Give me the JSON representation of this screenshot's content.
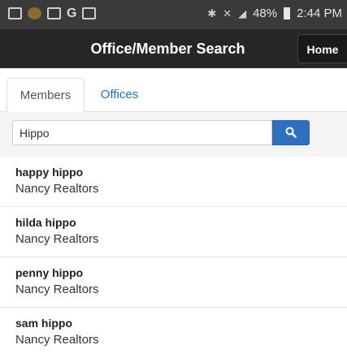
{
  "status_bar": {
    "battery": "48%",
    "time": "2:44 PM",
    "left_icons": [
      "voicemail-icon",
      "app-icon",
      "image-icon",
      "google-icon",
      "screenshot-icon"
    ],
    "g_letter": "G"
  },
  "header": {
    "title": "Office/Member Search",
    "home_label": "Home"
  },
  "tabs": [
    {
      "label": "Members",
      "active": true
    },
    {
      "label": "Offices",
      "active": false
    }
  ],
  "search": {
    "value": "Hippo",
    "placeholder": ""
  },
  "results": [
    {
      "name": "happy hippo",
      "office": "Nancy Realtors"
    },
    {
      "name": "hilda hippo",
      "office": "Nancy Realtors"
    },
    {
      "name": "penny hippo",
      "office": "Nancy Realtors"
    },
    {
      "name": "sam hippo",
      "office": "Nancy Realtors"
    }
  ],
  "colors": {
    "accent": "#2f6fc0",
    "link": "#1f73b7",
    "header_bg": "#262626",
    "statusbar_bg": "#3a3a3a"
  }
}
